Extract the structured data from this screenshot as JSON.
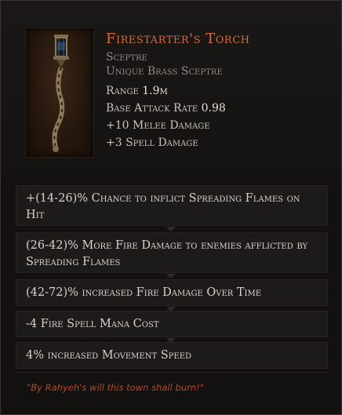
{
  "item": {
    "name": "Firestarter's Torch",
    "base_type": "Sceptre",
    "rarity_line": "Unique Brass Sceptre",
    "icon": "brass-sceptre-icon",
    "stats": {
      "range_label": "Range",
      "range_value": "1.9m",
      "attack_rate_label": "Base Attack Rate",
      "attack_rate_value": "0.98",
      "melee_damage": "+10 Melee Damage",
      "spell_damage": "+3 Spell Damage"
    }
  },
  "affixes": [
    "+(14-26)% Chance to inflict Spreading Flames on Hit",
    "(26-42)% More Fire Damage to enemies afflicted by Spreading Flames",
    "(42-72)% increased Fire Damage Over Time",
    "-4 Fire Spell Mana Cost",
    "4% increased Movement Speed"
  ],
  "lore": "\"By Rahyeh's will this town shall burn!\"",
  "colors": {
    "unique_name": "#d26a3d",
    "lore": "#b44a2e",
    "background": "#121110"
  }
}
